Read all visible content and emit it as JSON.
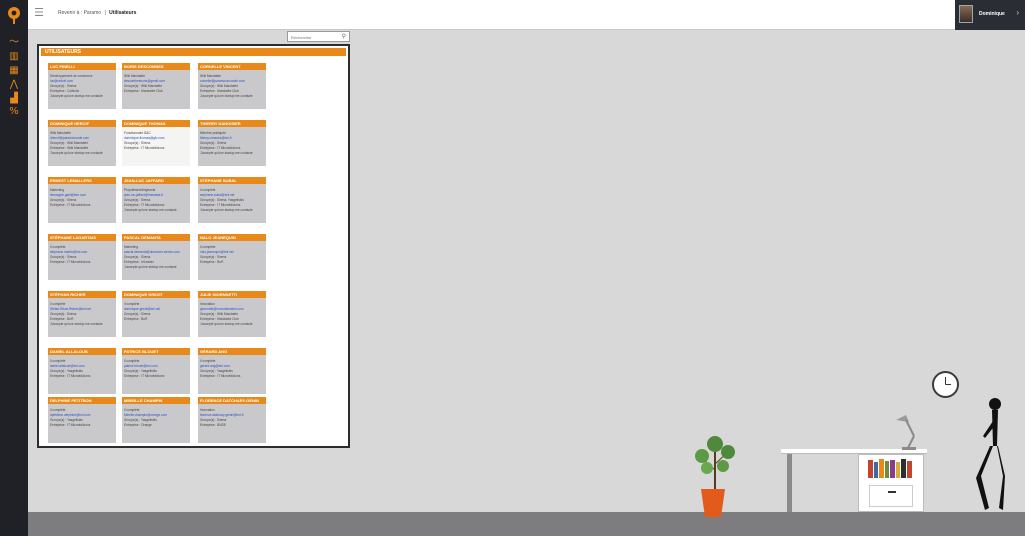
{
  "topbar": {
    "menu_icon": "hamburger-icon",
    "breadcrumb": {
      "back": "Revenir à : Paramo",
      "separator": "|",
      "current": "Utilisateurs"
    },
    "user": {
      "name": "Dominique",
      "chevron": "›"
    }
  },
  "rail_icons": [
    "chart-line-icon",
    "building-icon",
    "calculator-icon",
    "trend-icon",
    "bar-chart-icon",
    "percent-icon"
  ],
  "search": {
    "placeholder": "Rechercher",
    "icon": "⚲"
  },
  "panel": {
    "title": "UTILISATEURS"
  },
  "cards": [
    {
      "name": "LUC PINELLI",
      "lines": [
        "Développement de commerce",
        "luc@velicel.com",
        "Groupe(s) : Sirena",
        "Entreprise : Collectiv",
        "J'accepte qu'une startup me contacte"
      ],
      "mail_index": 1
    },
    {
      "name": "BORIS DESCOMBES",
      "lines": [
        "Wiki Mandatée",
        "descombesboris@gmail.com",
        "Groupe(s) : Wiki Mandatée",
        "Entreprise : Mandatée Club"
      ],
      "mail_index": 1
    },
    {
      "name": "CORNELLE VINCENT",
      "lines": [
        "Wiki Mandatée",
        "cornelle@paramovinconde.com",
        "Groupe(s) : Wiki Mandatée",
        "Entreprise : Mandatée Club",
        "J'accepte qu'une startup me contacte"
      ],
      "mail_index": 1
    },
    {
      "name": "DOMINIQUE HERCIF",
      "lines": [
        "Wiki Mandatée",
        "dhercif@paramovonde.com",
        "Groupe(s) : Wiki Mandatée",
        "Entreprise : Wiki Mandatée",
        "J'accepte qu'une startup me contacte"
      ],
      "mail_index": 1
    },
    {
      "name": "DOMINIQUE THOMAS",
      "lines": [
        "Fonctionnaire B&C",
        "dominique.thomas@gfc.com",
        "Groupe(s) : Sirena",
        "Entreprise : IT Microédicions"
      ],
      "mail_index": 1
    },
    {
      "name": "THIERRY DANOISIER",
      "lines": [
        "Membre pratiquée",
        "thierry.cimanes@bnl.fr",
        "Groupe(s) : Sirena",
        "Entreprise : IT Microédicions",
        "J'accepte qu'une startup me contacte"
      ],
      "mail_index": 1
    },
    {
      "name": "ERNEST LEMALLERS",
      "lines": [
        "Marketing",
        "lemacgeb.gael@ibm.com",
        "Groupe(s) : Sirena",
        "Entreprise : IT Microédicions"
      ],
      "mail_index": 1
    },
    {
      "name": "JEAN-LUC JAFFARD",
      "lines": [
        "Propriétaire/dirigeante",
        "jean-luc.jaffard@menatas.fr",
        "Groupe(s) : Sirena",
        "Entreprise : IT Microédicions",
        "J'accepte qu'une startup me contacte"
      ],
      "mail_index": 1
    },
    {
      "name": "STÉPHANE SUBAL",
      "lines": [
        "Il complète",
        "stephane.subal@bnl.net",
        "Groupe(s) : Sirena, Yasgelisbis",
        "Entreprise : IT Microédicions",
        "J'accepte qu'une startup me contacte"
      ],
      "mail_index": 1
    },
    {
      "name": "STÉPHANE LAGARTAIS",
      "lines": [
        "Il complète",
        "stephane.martin@bnl.com",
        "Groupe(s) : Sirena",
        "Entreprise : IT Microédicions"
      ],
      "mail_index": 1
    },
    {
      "name": "PASCAL DEMANTA",
      "lines": [
        "Marketing",
        "pascal.demanta@uboviorer.clerics.com",
        "Groupe(s) : Sirena",
        "Entreprise : IriLeader",
        "J'accepte qu'une startup me contacte"
      ],
      "mail_index": 1
    },
    {
      "name": "NALO JEANEQUIN",
      "lines": [
        "Il complète",
        "nalo.jeanequin@bnl.net",
        "Groupe(s) : Sirena",
        "Entreprise : BuR"
      ],
      "mail_index": 1
    },
    {
      "name": "STÉPHAN RICHER",
      "lines": [
        "Il complète",
        "Stefan.Rikus.Richer@bnl.net",
        "Groupe(s) : Sirena",
        "Entreprise : BuR",
        "J'accepte qu'une startup me contacte"
      ],
      "mail_index": 1
    },
    {
      "name": "DOMINIQUE GREZIT",
      "lines": [
        "Il complète",
        "dominique.grezit@bnl.net",
        "Groupe(s) : Sirena",
        "Entreprise : BuR"
      ],
      "mail_index": 1
    },
    {
      "name": "JULIE GIORNNETTI",
      "lines": [
        "Innovation",
        "giornnetti@innovationsbnl.com",
        "Groupe(s) : Wiki Mandatée",
        "Entreprise : Mandatée Club",
        "J'accepte qu'une startup me contacte"
      ],
      "mail_index": 1
    },
    {
      "name": "DANIEL ALLALOUB",
      "lines": [
        "Il complète",
        "daniel.allaloub@bnl.com",
        "Groupe(s) : Yasgelisbis",
        "Entreprise : IT Microédicions"
      ],
      "mail_index": 1
    },
    {
      "name": "PATRICE BLOUET",
      "lines": [
        "Il complète",
        "patrice.blouet@bnl.com",
        "Groupe(s) : Yasgelisbis",
        "Entreprise : IT Microédicions"
      ],
      "mail_index": 1
    },
    {
      "name": "GÉRARD ANG",
      "lines": [
        "Il complète",
        "gerard.ang@bnl.com",
        "Groupe(s) : Yasgelisbis",
        "Entreprise : IT Microédicions"
      ],
      "mail_index": 1
    },
    {
      "name": "DELPHINE PETITBON",
      "lines": [
        "Il complète",
        "dpetitbon.delphine@bnl.com",
        "Groupe(s) : Yasgelisbis",
        "Entreprise : IT Microédicions"
      ],
      "mail_index": 1
    },
    {
      "name": "MIREILLE CHAMPIN",
      "lines": [
        "Il complète",
        "Mireille.champin@orange.com",
        "Groupe(s) : Yasgelisbis",
        "Entreprise : Orange"
      ],
      "mail_index": 1
    },
    {
      "name": "FLORENCE DATCHARY-GENIN",
      "lines": [
        "Innovation",
        "florence.datchary-genin@bnl.fr",
        "Groupe(s) : Sirena",
        "Entreprise : BNDE"
      ],
      "mail_index": 1
    }
  ],
  "scene": {
    "accent": "#e8891a",
    "floor": "#7d7d80",
    "pot": "#e25a1c"
  }
}
